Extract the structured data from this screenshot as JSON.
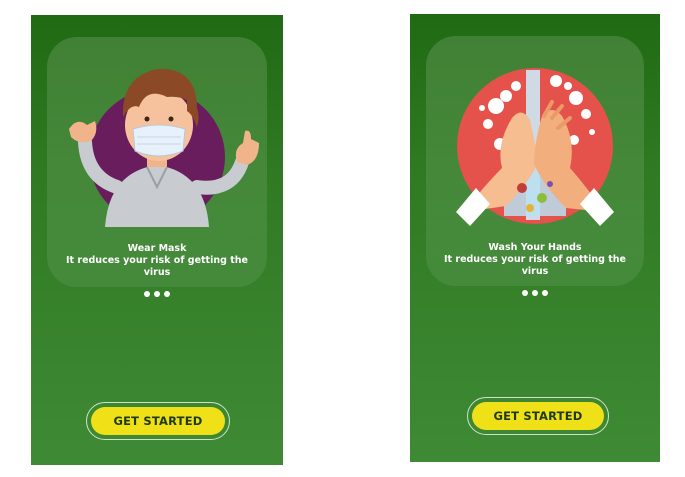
{
  "screens": [
    {
      "slide": {
        "title": "Wear Mask",
        "subtitle": "It reduces your risk of getting the virus",
        "illustration_icon": "face-mask-person-icon"
      },
      "pager": {
        "total": 3
      },
      "cta_label": "GET STARTED"
    },
    {
      "slide": {
        "title": "Wash Your Hands",
        "subtitle": "It reduces your risk of getting the virus",
        "illustration_icon": "hand-washing-icon"
      },
      "pager": {
        "total": 3
      },
      "cta_label": "GET STARTED"
    }
  ],
  "colors": {
    "background_green": "#2f7a22",
    "button_yellow": "#f0e018",
    "button_text": "#1d3a12"
  }
}
